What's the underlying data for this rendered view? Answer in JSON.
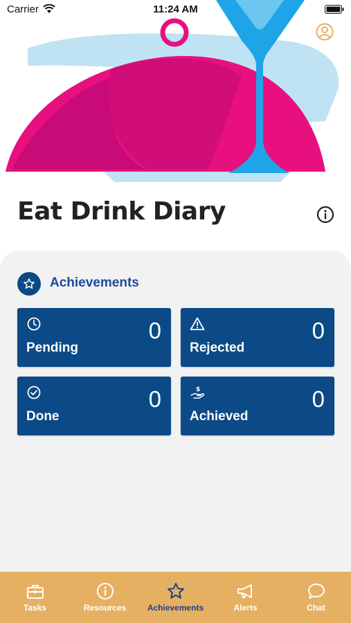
{
  "status_bar": {
    "carrier": "Carrier",
    "time": "11:24 AM"
  },
  "header": {
    "title": "Eat Drink Diary"
  },
  "achievements": {
    "section_title": "Achievements",
    "cards": [
      {
        "label": "Pending",
        "value": "0",
        "icon": "clock-icon"
      },
      {
        "label": "Rejected",
        "value": "0",
        "icon": "warning-icon"
      },
      {
        "label": "Done",
        "value": "0",
        "icon": "check-circle-icon"
      },
      {
        "label": "Achieved",
        "value": "0",
        "icon": "hand-dollar-icon"
      }
    ]
  },
  "tabs": [
    {
      "label": "Tasks",
      "icon": "briefcase-icon"
    },
    {
      "label": "Resources",
      "icon": "info-icon"
    },
    {
      "label": "Achievements",
      "icon": "star-icon",
      "active": true
    },
    {
      "label": "Alerts",
      "icon": "megaphone-icon"
    },
    {
      "label": "Chat",
      "icon": "chat-bubble-icon"
    }
  ],
  "colors": {
    "primary": "#0b4a86",
    "section_title": "#1f4a98",
    "tabbar": "#e6b062",
    "active_tab": "#1f3f86",
    "hero_pink": "#e8107e",
    "hero_blue": "#1ea5e8",
    "hero_light_blue": "#bfe3f3"
  }
}
